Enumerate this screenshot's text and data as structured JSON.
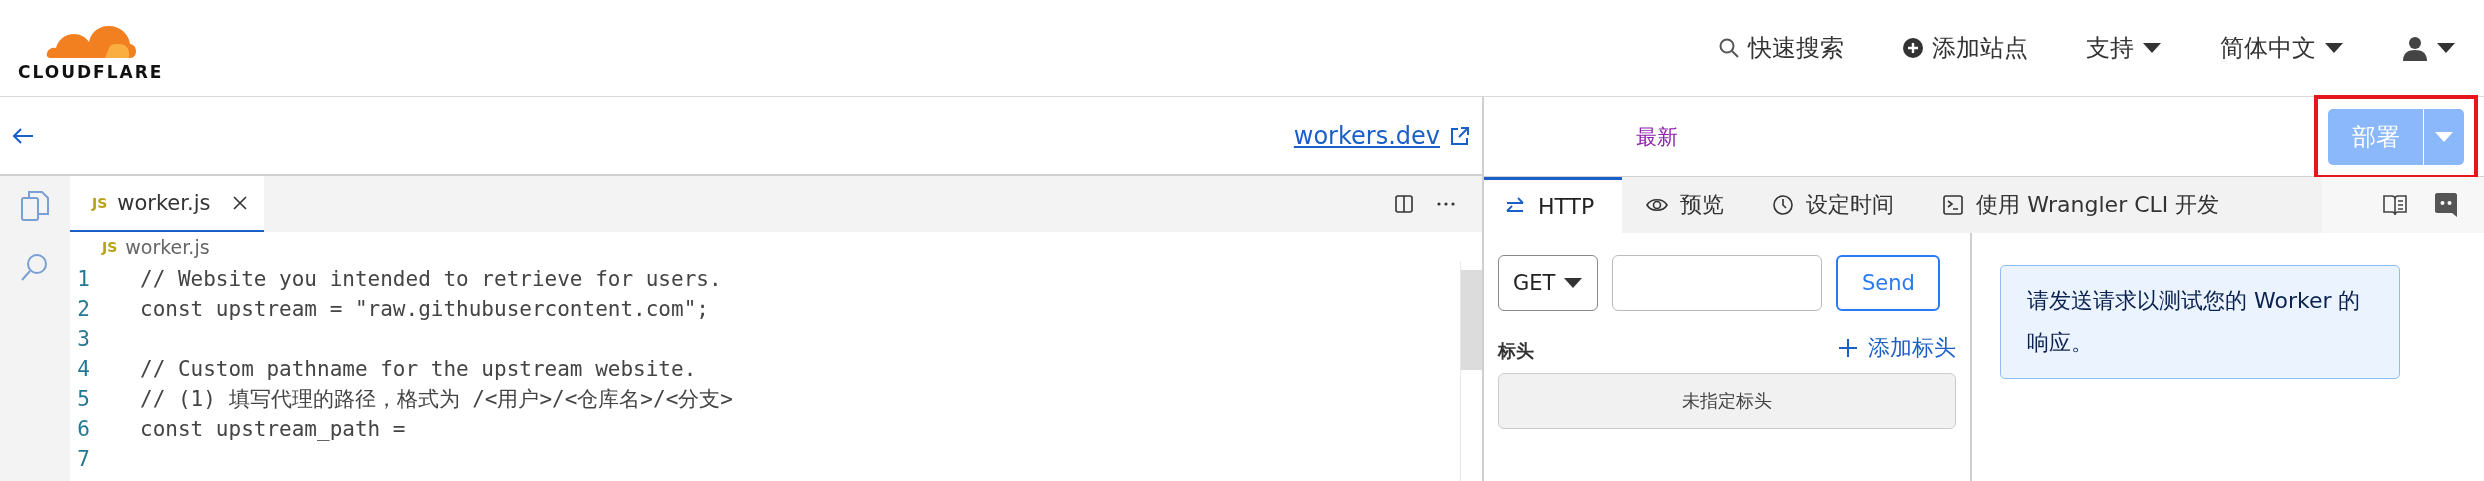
{
  "header": {
    "logo_text": "CLOUDFLARE",
    "nav": [
      {
        "kind": "search",
        "label": "快速搜索"
      },
      {
        "kind": "add",
        "label": "添加站点"
      },
      {
        "kind": "dropdown",
        "label": "支持"
      },
      {
        "kind": "dropdown",
        "label": "简体中文"
      },
      {
        "kind": "user"
      }
    ]
  },
  "toolbar": {
    "link": "workers.dev",
    "version_label": "最新",
    "deploy": {
      "label": "部署",
      "disabled": true,
      "highlighted": true
    }
  },
  "editor": {
    "tabs": [
      {
        "badge": "JS",
        "label": "worker.js",
        "selected": true
      }
    ],
    "breadcrumb": {
      "badge": "JS",
      "label": "worker.js"
    },
    "lines": [
      {
        "number": "1",
        "text": "// Website you intended to retrieve for users."
      },
      {
        "number": "2",
        "text": "const upstream = \"raw.githubusercontent.com\";"
      },
      {
        "number": "3"
      },
      {
        "number": "4",
        "text": "// Custom pathname for the upstream website."
      },
      {
        "number": "5",
        "text": "// (1) 填写代理的路径，格式为 /<用户>/<仓库名>/<分支>"
      },
      {
        "number": "6",
        "text": "const upstream_path ="
      },
      {
        "number": "7"
      }
    ]
  },
  "preview": {
    "tabs": [
      {
        "kind": "http",
        "label": "HTTP",
        "selected": true
      },
      {
        "kind": "eye",
        "label": "预览",
        "selected": false
      },
      {
        "kind": "clock",
        "label": "设定时间",
        "selected": false
      },
      {
        "kind": "terminal",
        "label": "使用 Wrangler CLI 开发",
        "selected": false
      }
    ],
    "request": {
      "method": "GET",
      "send": "Send",
      "headers_label": "标头",
      "add_header": "添加标头",
      "empty_headers": "未指定标头"
    },
    "response_message": "请发送请求以测试您的 Worker 的响应。"
  }
}
